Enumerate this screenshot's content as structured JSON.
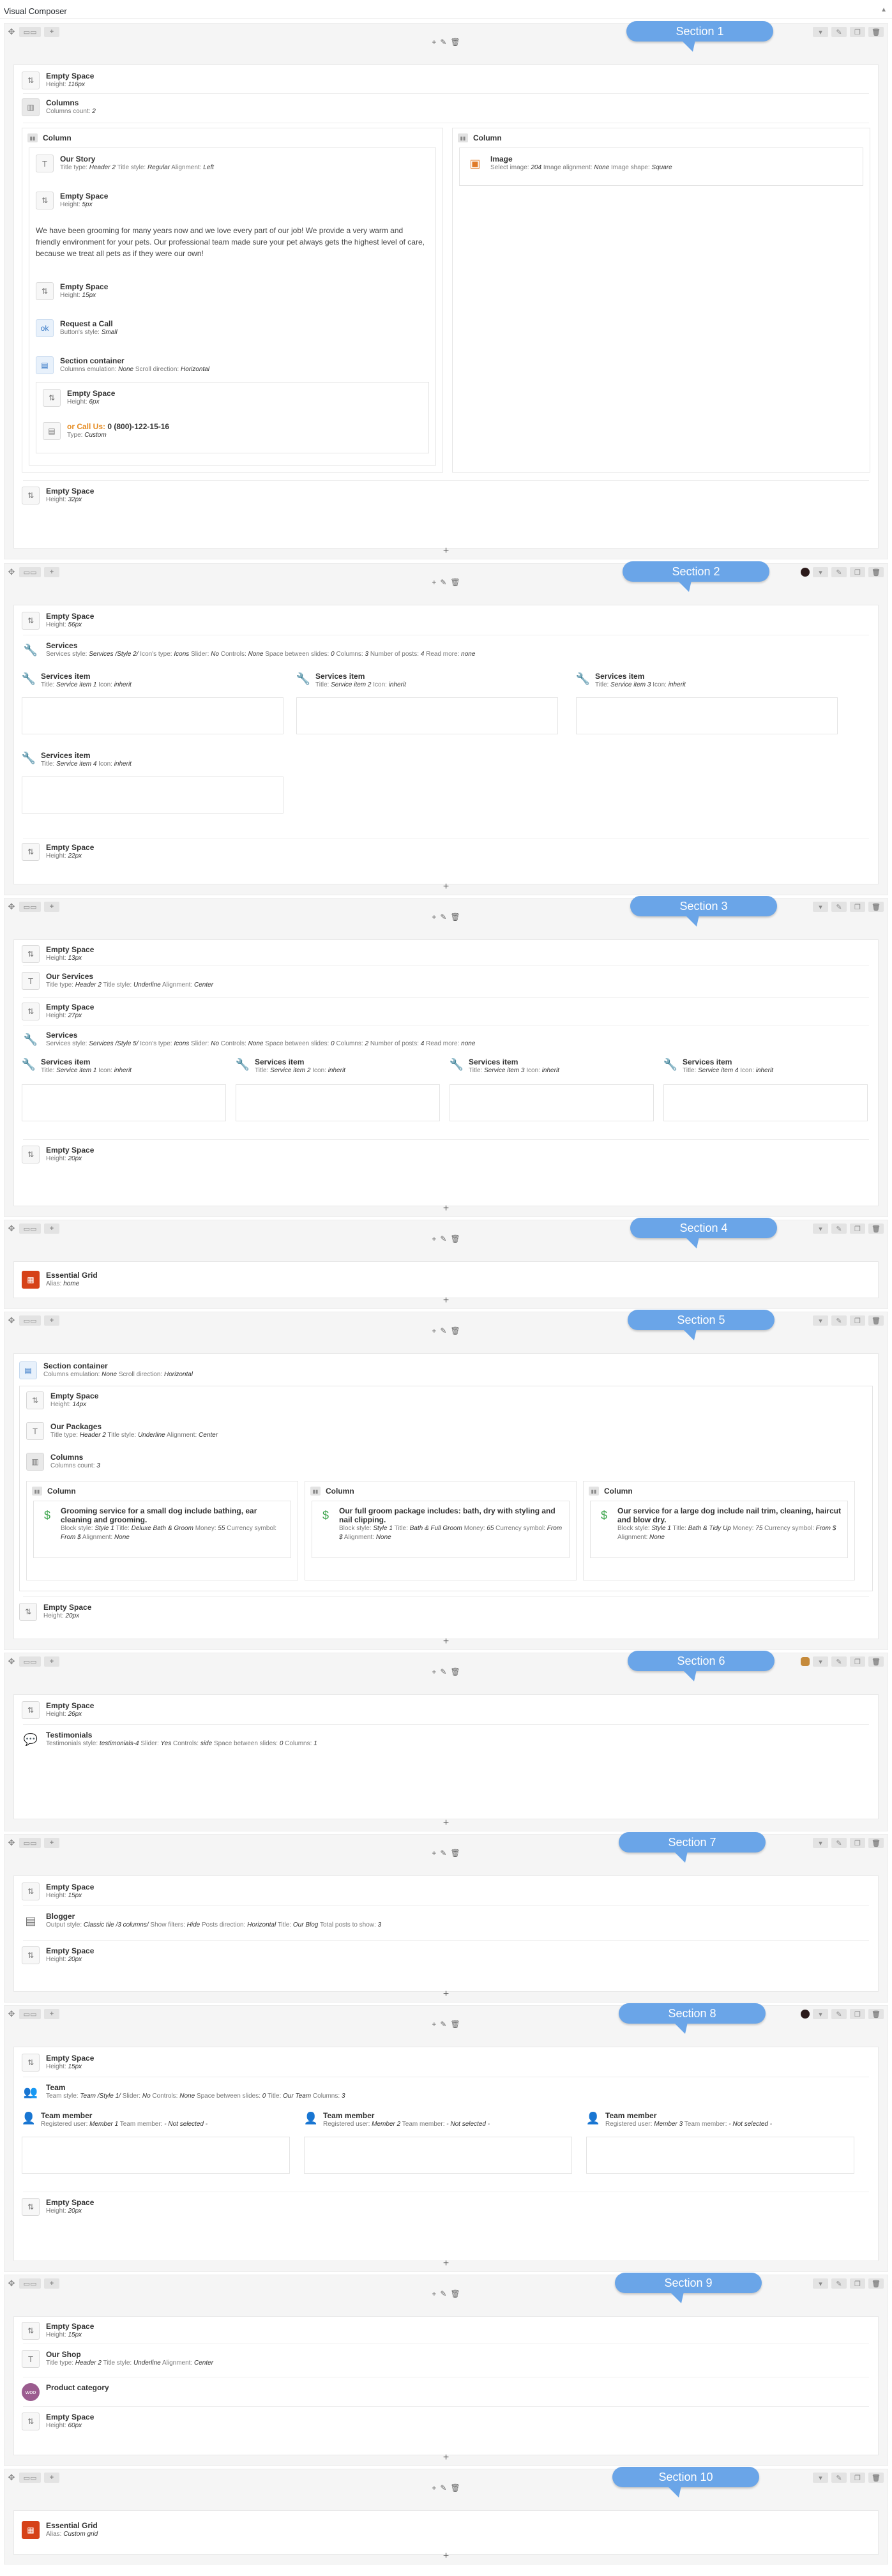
{
  "app": {
    "title": "Visual Composer",
    "collapse_icon": "triangle-up-icon"
  },
  "row_controls": {
    "move_icon": "move-icon",
    "layout_icon": "layout-icon",
    "add_icon": "+",
    "dropdown_icon": "▾",
    "edit_icon": "pencil-icon",
    "clone_icon": "clone-icon",
    "delete_icon": "trash-icon"
  },
  "mini_controls": {
    "add": "+",
    "edit": "✎",
    "delete": "🗑"
  },
  "add_element": "+",
  "sections": [
    {
      "label": "Section 1"
    },
    {
      "label": "Section 2"
    },
    {
      "label": "Section 3"
    },
    {
      "label": "Section 4"
    },
    {
      "label": "Section 5"
    },
    {
      "label": "Section 6"
    },
    {
      "label": "Section 7"
    },
    {
      "label": "Section 8"
    },
    {
      "label": "Section 9"
    },
    {
      "label": "Section 10"
    }
  ],
  "s1": {
    "es1": {
      "name": "Empty Space",
      "k": "Height:",
      "v": "116px"
    },
    "columns": {
      "name": "Columns",
      "k": "Columns count:",
      "v": "2"
    },
    "col_left": "Column",
    "col_right": "Column",
    "story": {
      "name": "Our Story",
      "p1": "Title type:",
      "v1": "Header 2",
      "p2": "Title style:",
      "v2": "Regular",
      "p3": "Alignment:",
      "v3": "Left"
    },
    "es2": {
      "name": "Empty Space",
      "k": "Height:",
      "v": "5px"
    },
    "text": "We have been grooming for many years now and we love every part of our job! We provide a very warm and friendly environment for your pets. Our professional team made sure your pet always gets the highest level of care, because we treat all pets as if they were our own!",
    "es3": {
      "name": "Empty Space",
      "k": "Height:",
      "v": "15px"
    },
    "call": {
      "name": "Request a Call",
      "k": "Button's style:",
      "v": "Small"
    },
    "container": {
      "name": "Section container",
      "p1": "Columns emulation:",
      "v1": "None",
      "p2": "Scroll direction:",
      "v2": "Horizontal"
    },
    "es4": {
      "name": "Empty Space",
      "k": "Height:",
      "v": "6px"
    },
    "callus": {
      "pre": "or Call Us:",
      "phone": "0 (800)-122-15-16",
      "k": "Type:",
      "v": "Custom"
    },
    "image": {
      "name": "Image",
      "p1": "Select image:",
      "v1": "204",
      "p2": "Image alignment:",
      "v2": "None",
      "p3": "Image shape:",
      "v3": "Square"
    },
    "es5": {
      "name": "Empty Space",
      "k": "Height:",
      "v": "32px"
    }
  },
  "s2": {
    "es1": {
      "name": "Empty Space",
      "k": "Height:",
      "v": "56px"
    },
    "services": {
      "name": "Services",
      "p1": "Services style:",
      "v1": "Services /Style 2/",
      "p2": "Icon's type:",
      "v2": "Icons",
      "p3": "Slider:",
      "v3": "No",
      "p4": "Controls:",
      "v4": "None",
      "p5": "Space between slides:",
      "v5": "0",
      "p6": "Columns:",
      "v6": "3",
      "p7": "Number of posts:",
      "v7": "4",
      "p8": "Read more:",
      "v8": "none"
    },
    "items": [
      {
        "name": "Services item",
        "k1": "Title:",
        "v1": "Service item 1",
        "k2": "Icon:",
        "v2": "inherit"
      },
      {
        "name": "Services item",
        "k1": "Title:",
        "v1": "Service item 2",
        "k2": "Icon:",
        "v2": "inherit"
      },
      {
        "name": "Services item",
        "k1": "Title:",
        "v1": "Service item 3",
        "k2": "Icon:",
        "v2": "inherit"
      },
      {
        "name": "Services item",
        "k1": "Title:",
        "v1": "Service item 4",
        "k2": "Icon:",
        "v2": "inherit"
      }
    ],
    "es2": {
      "name": "Empty Space",
      "k": "Height:",
      "v": "22px"
    }
  },
  "s3": {
    "es1": {
      "name": "Empty Space",
      "k": "Height:",
      "v": "13px"
    },
    "title": {
      "name": "Our Services",
      "p1": "Title type:",
      "v1": "Header 2",
      "p2": "Title style:",
      "v2": "Underline",
      "p3": "Alignment:",
      "v3": "Center"
    },
    "es2": {
      "name": "Empty Space",
      "k": "Height:",
      "v": "27px"
    },
    "services": {
      "name": "Services",
      "p1": "Services style:",
      "v1": "Services /Style 5/",
      "p2": "Icon's type:",
      "v2": "Icons",
      "p3": "Slider:",
      "v3": "No",
      "p4": "Controls:",
      "v4": "None",
      "p5": "Space between slides:",
      "v5": "0",
      "p6": "Columns:",
      "v6": "2",
      "p7": "Number of posts:",
      "v7": "4",
      "p8": "Read more:",
      "v8": "none"
    },
    "items": [
      {
        "name": "Services item",
        "k1": "Title:",
        "v1": "Service item 1",
        "k2": "Icon:",
        "v2": "inherit"
      },
      {
        "name": "Services item",
        "k1": "Title:",
        "v1": "Service item 2",
        "k2": "Icon:",
        "v2": "inherit"
      },
      {
        "name": "Services item",
        "k1": "Title:",
        "v1": "Service item 3",
        "k2": "Icon:",
        "v2": "inherit"
      },
      {
        "name": "Services item",
        "k1": "Title:",
        "v1": "Service item 4",
        "k2": "Icon:",
        "v2": "inherit"
      }
    ],
    "es3": {
      "name": "Empty Space",
      "k": "Height:",
      "v": "20px"
    }
  },
  "s4": {
    "grid": {
      "name": "Essential Grid",
      "k": "Alias:",
      "v": "home"
    }
  },
  "s5": {
    "container": {
      "name": "Section container",
      "p1": "Columns emulation:",
      "v1": "None",
      "p2": "Scroll direction:",
      "v2": "Horizontal"
    },
    "es1": {
      "name": "Empty Space",
      "k": "Height:",
      "v": "14px"
    },
    "title": {
      "name": "Our Packages",
      "p1": "Title type:",
      "v1": "Header 2",
      "p2": "Title style:",
      "v2": "Underline",
      "p3": "Alignment:",
      "v3": "Center"
    },
    "columns": {
      "name": "Columns",
      "k": "Columns count:",
      "v": "3"
    },
    "cols": [
      {
        "label": "Column",
        "name": "Grooming service for a small dog include bathing, ear cleaning and grooming.",
        "p1": "Block style:",
        "v1": "Style 1",
        "p2": "Title:",
        "v2": "Deluxe Bath & Groom",
        "p3": "Money:",
        "v3": "55",
        "p4": "Currency symbol:",
        "v4": "From $",
        "p5": "Alignment:",
        "v5": "None"
      },
      {
        "label": "Column",
        "name": "Our full groom package includes: bath, dry with styling and nail clipping.",
        "p1": "Block style:",
        "v1": "Style 1",
        "p2": "Title:",
        "v2": "Bath & Full Groom",
        "p3": "Money:",
        "v3": "65",
        "p4": "Currency symbol:",
        "v4": "From $",
        "p5": "Alignment:",
        "v5": "None"
      },
      {
        "label": "Column",
        "name": "Our service for a large dog include nail trim, cleaning, haircut and blow dry.",
        "p1": "Block style:",
        "v1": "Style 1",
        "p2": "Title:",
        "v2": "Bath & Tidy Up",
        "p3": "Money:",
        "v3": "75",
        "p4": "Currency symbol:",
        "v4": "From $",
        "p5": "Alignment:",
        "v5": "None"
      }
    ],
    "es2": {
      "name": "Empty Space",
      "k": "Height:",
      "v": "20px"
    }
  },
  "s6": {
    "es1": {
      "name": "Empty Space",
      "k": "Height:",
      "v": "26px"
    },
    "testi": {
      "name": "Testimonials",
      "p1": "Testimonials style:",
      "v1": "testimonials-4",
      "p2": "Slider:",
      "v2": "Yes",
      "p3": "Controls:",
      "v3": "side",
      "p4": "Space between slides:",
      "v4": "0",
      "p5": "Columns:",
      "v5": "1"
    }
  },
  "s7": {
    "es1": {
      "name": "Empty Space",
      "k": "Height:",
      "v": "15px"
    },
    "blog": {
      "name": "Blogger",
      "p1": "Output style:",
      "v1": "Classic tile /3 columns/",
      "p2": "Show filters:",
      "v2": "Hide",
      "p3": "Posts direction:",
      "v3": "Horizontal",
      "p4": "Title:",
      "v4": "Our Blog",
      "p5": "Total posts to show:",
      "v5": "3"
    },
    "es2": {
      "name": "Empty Space",
      "k": "Height:",
      "v": "20px"
    }
  },
  "s8": {
    "es1": {
      "name": "Empty Space",
      "k": "Height:",
      "v": "15px"
    },
    "team": {
      "name": "Team",
      "p1": "Team style:",
      "v1": "Team /Style 1/",
      "p2": "Slider:",
      "v2": "No",
      "p3": "Controls:",
      "v3": "None",
      "p4": "Space between slides:",
      "v4": "0",
      "p5": "Title:",
      "v5": "Our Team",
      "p6": "Columns:",
      "v6": "3"
    },
    "members": [
      {
        "name": "Team member",
        "k1": "Registered user:",
        "v1": "Member 1",
        "k2": "Team member:",
        "v2": "- Not selected -"
      },
      {
        "name": "Team member",
        "k1": "Registered user:",
        "v1": "Member 2",
        "k2": "Team member:",
        "v2": "- Not selected -"
      },
      {
        "name": "Team member",
        "k1": "Registered user:",
        "v1": "Member 3",
        "k2": "Team member:",
        "v2": "- Not selected -"
      }
    ],
    "es2": {
      "name": "Empty Space",
      "k": "Height:",
      "v": "20px"
    }
  },
  "s9": {
    "es1": {
      "name": "Empty Space",
      "k": "Height:",
      "v": "15px"
    },
    "title": {
      "name": "Our Shop",
      "p1": "Title type:",
      "v1": "Header 2",
      "p2": "Title style:",
      "v2": "Underline",
      "p3": "Alignment:",
      "v3": "Center"
    },
    "cat": {
      "name": "Product category",
      "icon_text": "woo"
    },
    "es2": {
      "name": "Empty Space",
      "k": "Height:",
      "v": "60px"
    }
  },
  "s10": {
    "grid": {
      "name": "Essential Grid",
      "k": "Alias:",
      "v": "Custom grid"
    }
  },
  "colors": {
    "bubble": "#6aa5e8",
    "accent": "#e58a1f",
    "grid_red": "#d64218",
    "woo_purple": "#9b5c8f"
  }
}
